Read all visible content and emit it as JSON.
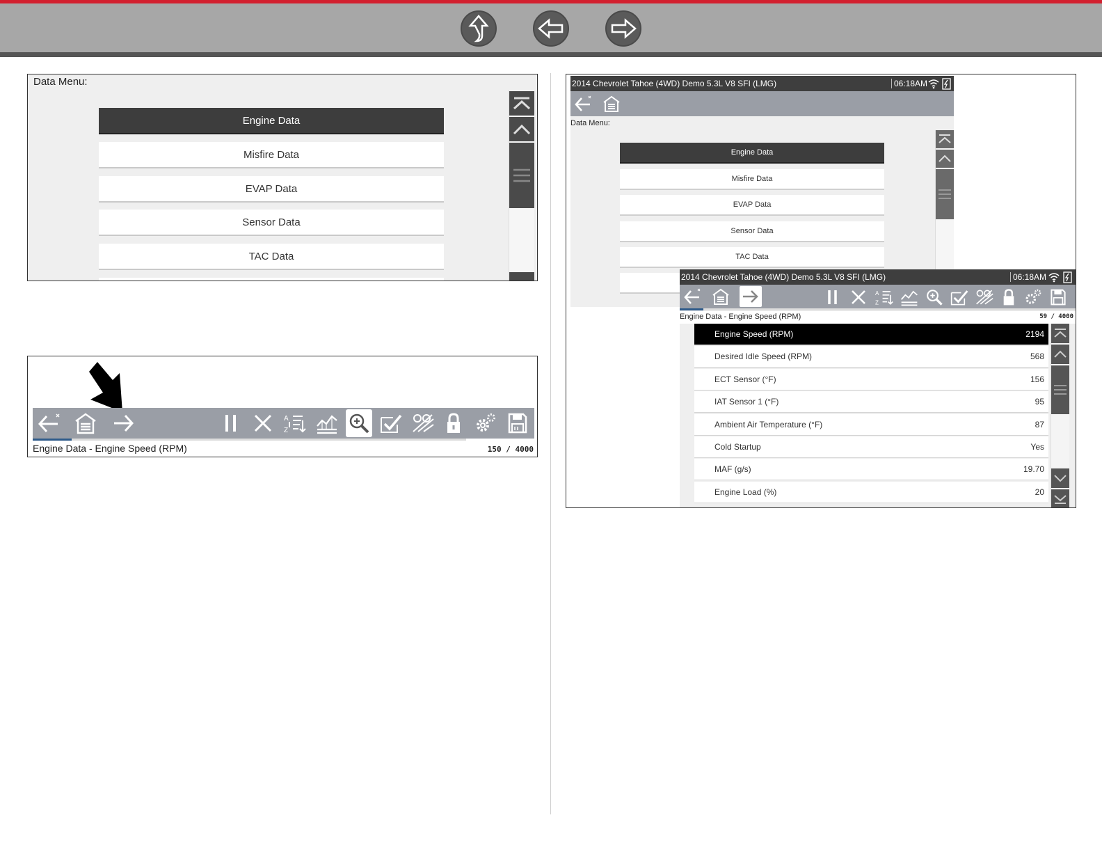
{
  "page_nav": {
    "buttons": [
      {
        "name": "up-arrow-icon"
      },
      {
        "name": "left-arrow-icon"
      },
      {
        "name": "right-arrow-icon"
      }
    ]
  },
  "panel_a": {
    "menu_title": "Data Menu:",
    "items": [
      "Engine Data",
      "Misfire Data",
      "EVAP Data",
      "Sensor Data",
      "TAC Data"
    ],
    "selected_index": 0
  },
  "panel_b": {
    "toolbar_icons": [
      "back-icon",
      "home-icon",
      "forward-icon",
      "pause-icon",
      "clear-icon",
      "sort-icon",
      "graph-icon",
      "zoom-icon",
      "checkmark-icon",
      "percent-icon",
      "lock-icon",
      "settings-icon",
      "save-icon"
    ],
    "active_icon": "zoom-icon",
    "status_title": "Engine Data - Engine Speed (RPM)",
    "counter": "150 / 4000"
  },
  "panel_c": {
    "back_screen": {
      "title": "2014 Chevrolet Tahoe (4WD) Demo 5.3L V8 SFI (LMG)",
      "time": "06:18AM",
      "menu_title": "Data Menu:",
      "items": [
        "Engine Data",
        "Misfire Data",
        "EVAP Data",
        "Sensor Data",
        "TAC Data"
      ]
    },
    "front_screen": {
      "title": "2014 Chevrolet Tahoe (4WD) Demo 5.3L V8 SFI (LMG)",
      "time": "06:18AM",
      "status_title": "Engine Data - Engine Speed (RPM)",
      "counter": "59 / 4000",
      "rows": [
        {
          "label": "Engine Speed (RPM)",
          "value": "2194"
        },
        {
          "label": "Desired Idle Speed (RPM)",
          "value": "568"
        },
        {
          "label": "ECT Sensor (°F)",
          "value": "156"
        },
        {
          "label": "IAT Sensor 1 (°F)",
          "value": "95"
        },
        {
          "label": "Ambient Air Temperature (°F)",
          "value": "87"
        },
        {
          "label": "Cold Startup",
          "value": "Yes"
        },
        {
          "label": "MAF (g/s)",
          "value": "19.70"
        },
        {
          "label": "Engine Load (%)",
          "value": "20"
        }
      ]
    }
  },
  "colors": {
    "accent_red": "#d3202f",
    "toolbar_gray": "#9a9ea6",
    "selected_dark": "#3d3d3d",
    "progress_blue": "#2e5a8a"
  }
}
